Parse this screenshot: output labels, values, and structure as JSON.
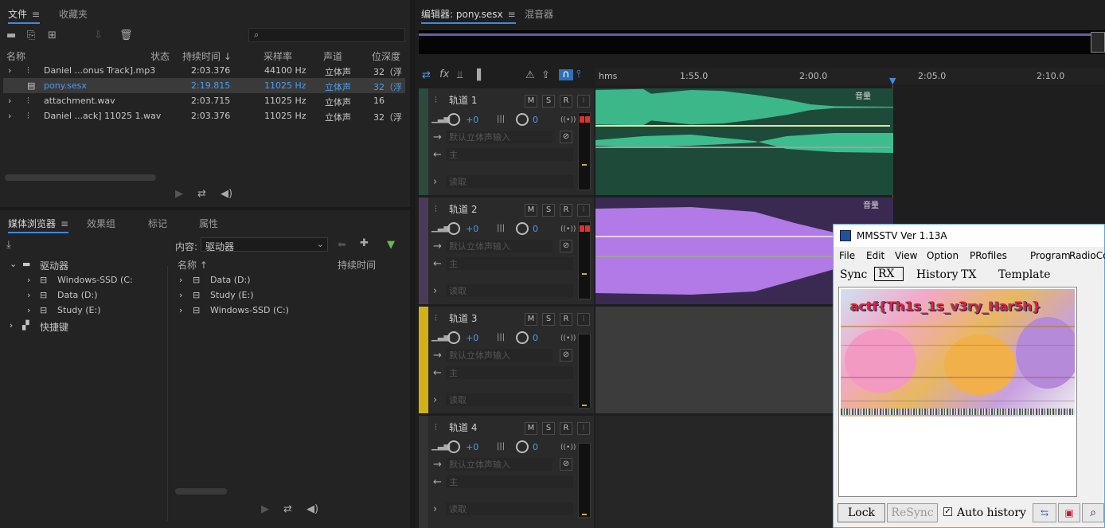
{
  "files_panel": {
    "tabs": [
      "文件",
      "收藏夹"
    ],
    "search_placeholder": "",
    "columns": [
      "名称",
      "状态",
      "持续时间",
      "采样率",
      "声道",
      "位深度"
    ],
    "rows": [
      {
        "name": "Daniel ...onus Track].mp3",
        "duration": "2:03.376",
        "rate": "44100 Hz",
        "channels": "立体声",
        "depth": "32（浮"
      },
      {
        "name": "pony.sesx",
        "duration": "2:19.815",
        "rate": "11025 Hz",
        "channels": "立体声",
        "depth": "32（浮"
      },
      {
        "name": "attachment.wav",
        "duration": "2:03.715",
        "rate": "11025 Hz",
        "channels": "立体声",
        "depth": "16"
      },
      {
        "name": "Daniel ...ack] 11025 1.wav",
        "duration": "2:03.376",
        "rate": "11025 Hz",
        "channels": "立体声",
        "depth": "32（浮"
      }
    ]
  },
  "media_panel": {
    "tabs": [
      "媒体浏览器",
      "效果组",
      "标记",
      "属性"
    ],
    "content_label": "内容:",
    "content_value": "驱动器",
    "tree": {
      "root": "驱动器",
      "drives": [
        "Windows-SSD (C:",
        "Data (D:)",
        "Study (E:)"
      ],
      "shortcuts": "快捷键"
    },
    "list_columns": [
      "名称",
      "持续时间"
    ],
    "list": [
      "Data (D:)",
      "Study (E:)",
      "Windows-SSD (C:)"
    ]
  },
  "editor": {
    "tabs": [
      "编辑器: pony.sesx",
      "混音器"
    ],
    "ruler": [
      "hms",
      "1:55.0",
      "2:00.0",
      "2:05.0",
      "2:10.0"
    ],
    "volume_label": "音量",
    "tracks": [
      {
        "name": "轨道 1",
        "vol": "+0",
        "pan": "0",
        "input": "默认立体声输入",
        "output": "主",
        "mode": "读取",
        "color": "#3dbd8e"
      },
      {
        "name": "轨道 2",
        "vol": "+0",
        "pan": "0",
        "input": "默认立体声输入",
        "output": "主",
        "mode": "读取",
        "color": "#b17ae6"
      },
      {
        "name": "轨道 3",
        "vol": "+0",
        "pan": "0",
        "input": "默认立体声输入",
        "output": "主",
        "mode": "读取",
        "color": "#e0c020"
      },
      {
        "name": "轨道 4",
        "vol": "+0",
        "pan": "0",
        "input": "默认立体声输入",
        "output": "主",
        "mode": "读取",
        "color": "#404040"
      }
    ],
    "track_buttons": [
      "M",
      "S",
      "R",
      "I"
    ]
  },
  "mmsstv": {
    "title": "MMSSTV Ver 1.13A",
    "menu": [
      "File",
      "Edit",
      "View",
      "Option",
      "PRofiles",
      "Program",
      "RadioCo"
    ],
    "tabs": [
      "Sync",
      "RX",
      "History",
      "TX",
      "Template"
    ],
    "image_text": "actf{Th1s_1s_v3ry_Har5h}",
    "lock": "Lock",
    "resync": "ReSync",
    "auto_history": "Auto history",
    "auto_history_checked": true
  }
}
